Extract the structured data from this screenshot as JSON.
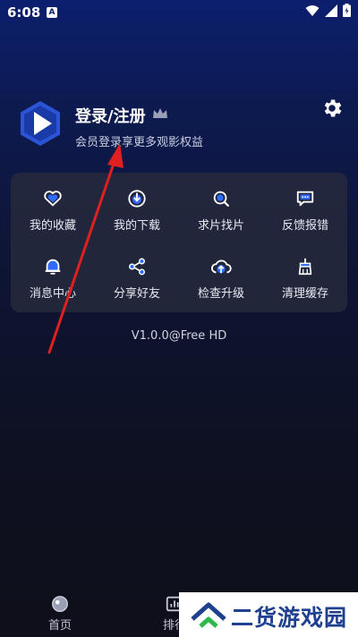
{
  "status_bar": {
    "time": "6:08",
    "notification_glyph": "A"
  },
  "profile": {
    "title": "登录/注册",
    "subtitle": "会员登录享更多观影权益"
  },
  "menu": {
    "items": [
      {
        "label": "我的收藏",
        "icon": "heart-icon"
      },
      {
        "label": "我的下载",
        "icon": "download-icon"
      },
      {
        "label": "求片找片",
        "icon": "search-movie-icon"
      },
      {
        "label": "反馈报错",
        "icon": "feedback-icon"
      },
      {
        "label": "消息中心",
        "icon": "bell-icon"
      },
      {
        "label": "分享好友",
        "icon": "share-icon"
      },
      {
        "label": "检查升级",
        "icon": "cloud-upload-icon"
      },
      {
        "label": "清理缓存",
        "icon": "broom-icon"
      }
    ]
  },
  "version": "V1.0.0@Free HD",
  "tabbar": {
    "home": "首页",
    "rank": "排行"
  },
  "watermark": {
    "text": "二货游戏园"
  },
  "colors": {
    "accent": "#2f6bff",
    "annotation_arrow": "#e02020"
  }
}
